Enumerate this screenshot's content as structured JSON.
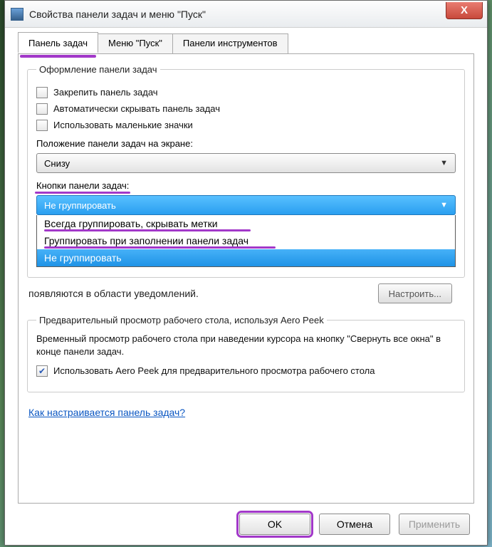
{
  "window": {
    "title": "Свойства панели задач и меню \"Пуск\"",
    "close_glyph": "X"
  },
  "tabs": {
    "taskbar": "Панель задач",
    "start": "Меню \"Пуск\"",
    "toolbars": "Панели инструментов"
  },
  "appearance": {
    "legend": "Оформление панели задач",
    "lock": "Закрепить панель задач",
    "autohide": "Автоматически скрывать панель задач",
    "small_icons": "Использовать маленькие значки",
    "position_label": "Положение панели задач на экране:",
    "position_value": "Снизу",
    "buttons_label": "Кнопки панели задач:",
    "buttons_value": "Не группировать",
    "buttons_options": {
      "always": "Всегда группировать, скрывать метки",
      "when_full": "Группировать при заполнении панели задач",
      "never": "Не группировать"
    }
  },
  "behind_dropdown_text": "появляются в области уведомлений.",
  "configure_label": "Настроить...",
  "aero": {
    "legend": "Предварительный просмотр рабочего стола, используя Aero Peek",
    "desc": "Временный просмотр рабочего стола при наведении курсора на кнопку \"Свернуть все окна\" в конце панели задач.",
    "checkbox": "Использовать Aero Peek для предварительного просмотра рабочего стола"
  },
  "help_link": "Как настраивается панель задач?",
  "buttons": {
    "ok": "OK",
    "cancel": "Отмена",
    "apply": "Применить"
  },
  "icons": {
    "chevron_down": "▼",
    "checkmark": "✔"
  }
}
